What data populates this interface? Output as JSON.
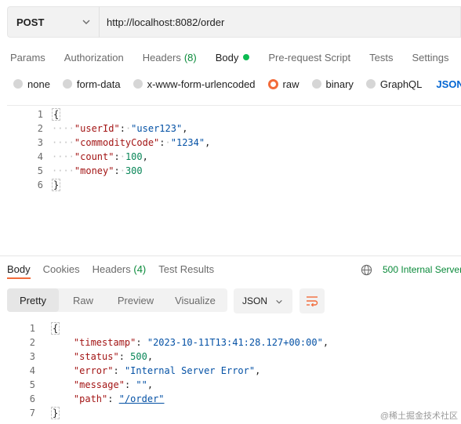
{
  "request": {
    "method": "POST",
    "url": "http://localhost:8082/order"
  },
  "request_tabs": [
    {
      "label": "Params"
    },
    {
      "label": "Authorization"
    },
    {
      "label": "Headers",
      "count": "(8)"
    },
    {
      "label": "Body"
    },
    {
      "label": "Pre-request Script"
    },
    {
      "label": "Tests"
    },
    {
      "label": "Settings"
    }
  ],
  "body_types": [
    "none",
    "form-data",
    "x-www-form-urlencoded",
    "raw",
    "binary",
    "GraphQL"
  ],
  "body_format": "JSON",
  "request_body": {
    "line_numbers": [
      "1",
      "2",
      "3",
      "4",
      "5",
      "6"
    ],
    "open_brace": "{",
    "close_brace": "}",
    "fields": [
      {
        "key": "\"userId\"",
        "value": "\"user123\"",
        "trail": ","
      },
      {
        "key": "\"commodityCode\"",
        "value": "\"1234\"",
        "trail": ","
      },
      {
        "key": "\"count\"",
        "value": "100",
        "trail": ","
      },
      {
        "key": "\"money\"",
        "value": "300",
        "trail": ""
      }
    ]
  },
  "response_tabs": [
    {
      "label": "Body"
    },
    {
      "label": "Cookies"
    },
    {
      "label": "Headers",
      "count": "(4)"
    },
    {
      "label": "Test Results"
    }
  ],
  "response_status": "500 Internal Server",
  "view_modes": [
    "Pretty",
    "Raw",
    "Preview",
    "Visualize"
  ],
  "response_format": "JSON",
  "response_body": {
    "line_numbers": [
      "1",
      "2",
      "3",
      "4",
      "5",
      "6",
      "7"
    ],
    "open_brace": "{",
    "close_brace": "}",
    "fields": [
      {
        "key": "\"timestamp\"",
        "value": "\"2023-10-11T13:41:28.127+00:00\"",
        "trail": ","
      },
      {
        "key": "\"status\"",
        "value": "500",
        "trail": ","
      },
      {
        "key": "\"error\"",
        "value": "\"Internal Server Error\"",
        "trail": ","
      },
      {
        "key": "\"message\"",
        "value": "\"\"",
        "trail": ","
      },
      {
        "key": "\"path\"",
        "value": "\"/order\"",
        "trail": ""
      }
    ]
  },
  "watermark": "@稀土掘金技术社区",
  "colors": {
    "accent": "#f26b3a",
    "status_error_text": "#0a8a3a",
    "json_link": "#0265d2"
  }
}
